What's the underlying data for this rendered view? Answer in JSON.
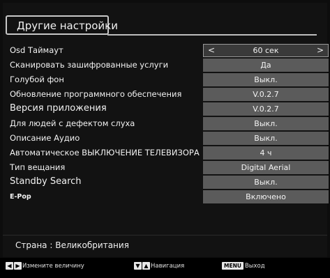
{
  "menu": {
    "title": "Другие настройки",
    "rows": [
      {
        "label": "Osd Таймаут",
        "value": "60 сек",
        "selected": true
      },
      {
        "label": "Сканировать зашифрованные услуги",
        "value": "Да"
      },
      {
        "label": "Голубой фон",
        "value": "Выкл."
      },
      {
        "label": "Обновление программного обеспечения",
        "value": "V.0.2.7"
      },
      {
        "label": "Версия приложения",
        "value": "V.0.2.7"
      },
      {
        "label": "Для людей с дефектом слуха",
        "value": "Выкл."
      },
      {
        "label": "Описание Аудио",
        "value": "Выкл."
      },
      {
        "label": "Автоматическое ВЫКЛЮЧЕНИЕ ТЕЛЕВИЗОРА",
        "value": "4 ч"
      },
      {
        "label": "Тип вещания",
        "value": "Digital Aerial"
      },
      {
        "label": "Standby Search",
        "value": "Выкл."
      },
      {
        "label": "E-Pop",
        "value": "Включено"
      }
    ],
    "arrows": {
      "left": "<",
      "right": ">"
    }
  },
  "country": "Страна : Великобритания",
  "footer": {
    "change_value": "Измените величину",
    "navigation": "Навигация",
    "menu_key": "MENU",
    "exit": "Выход"
  }
}
